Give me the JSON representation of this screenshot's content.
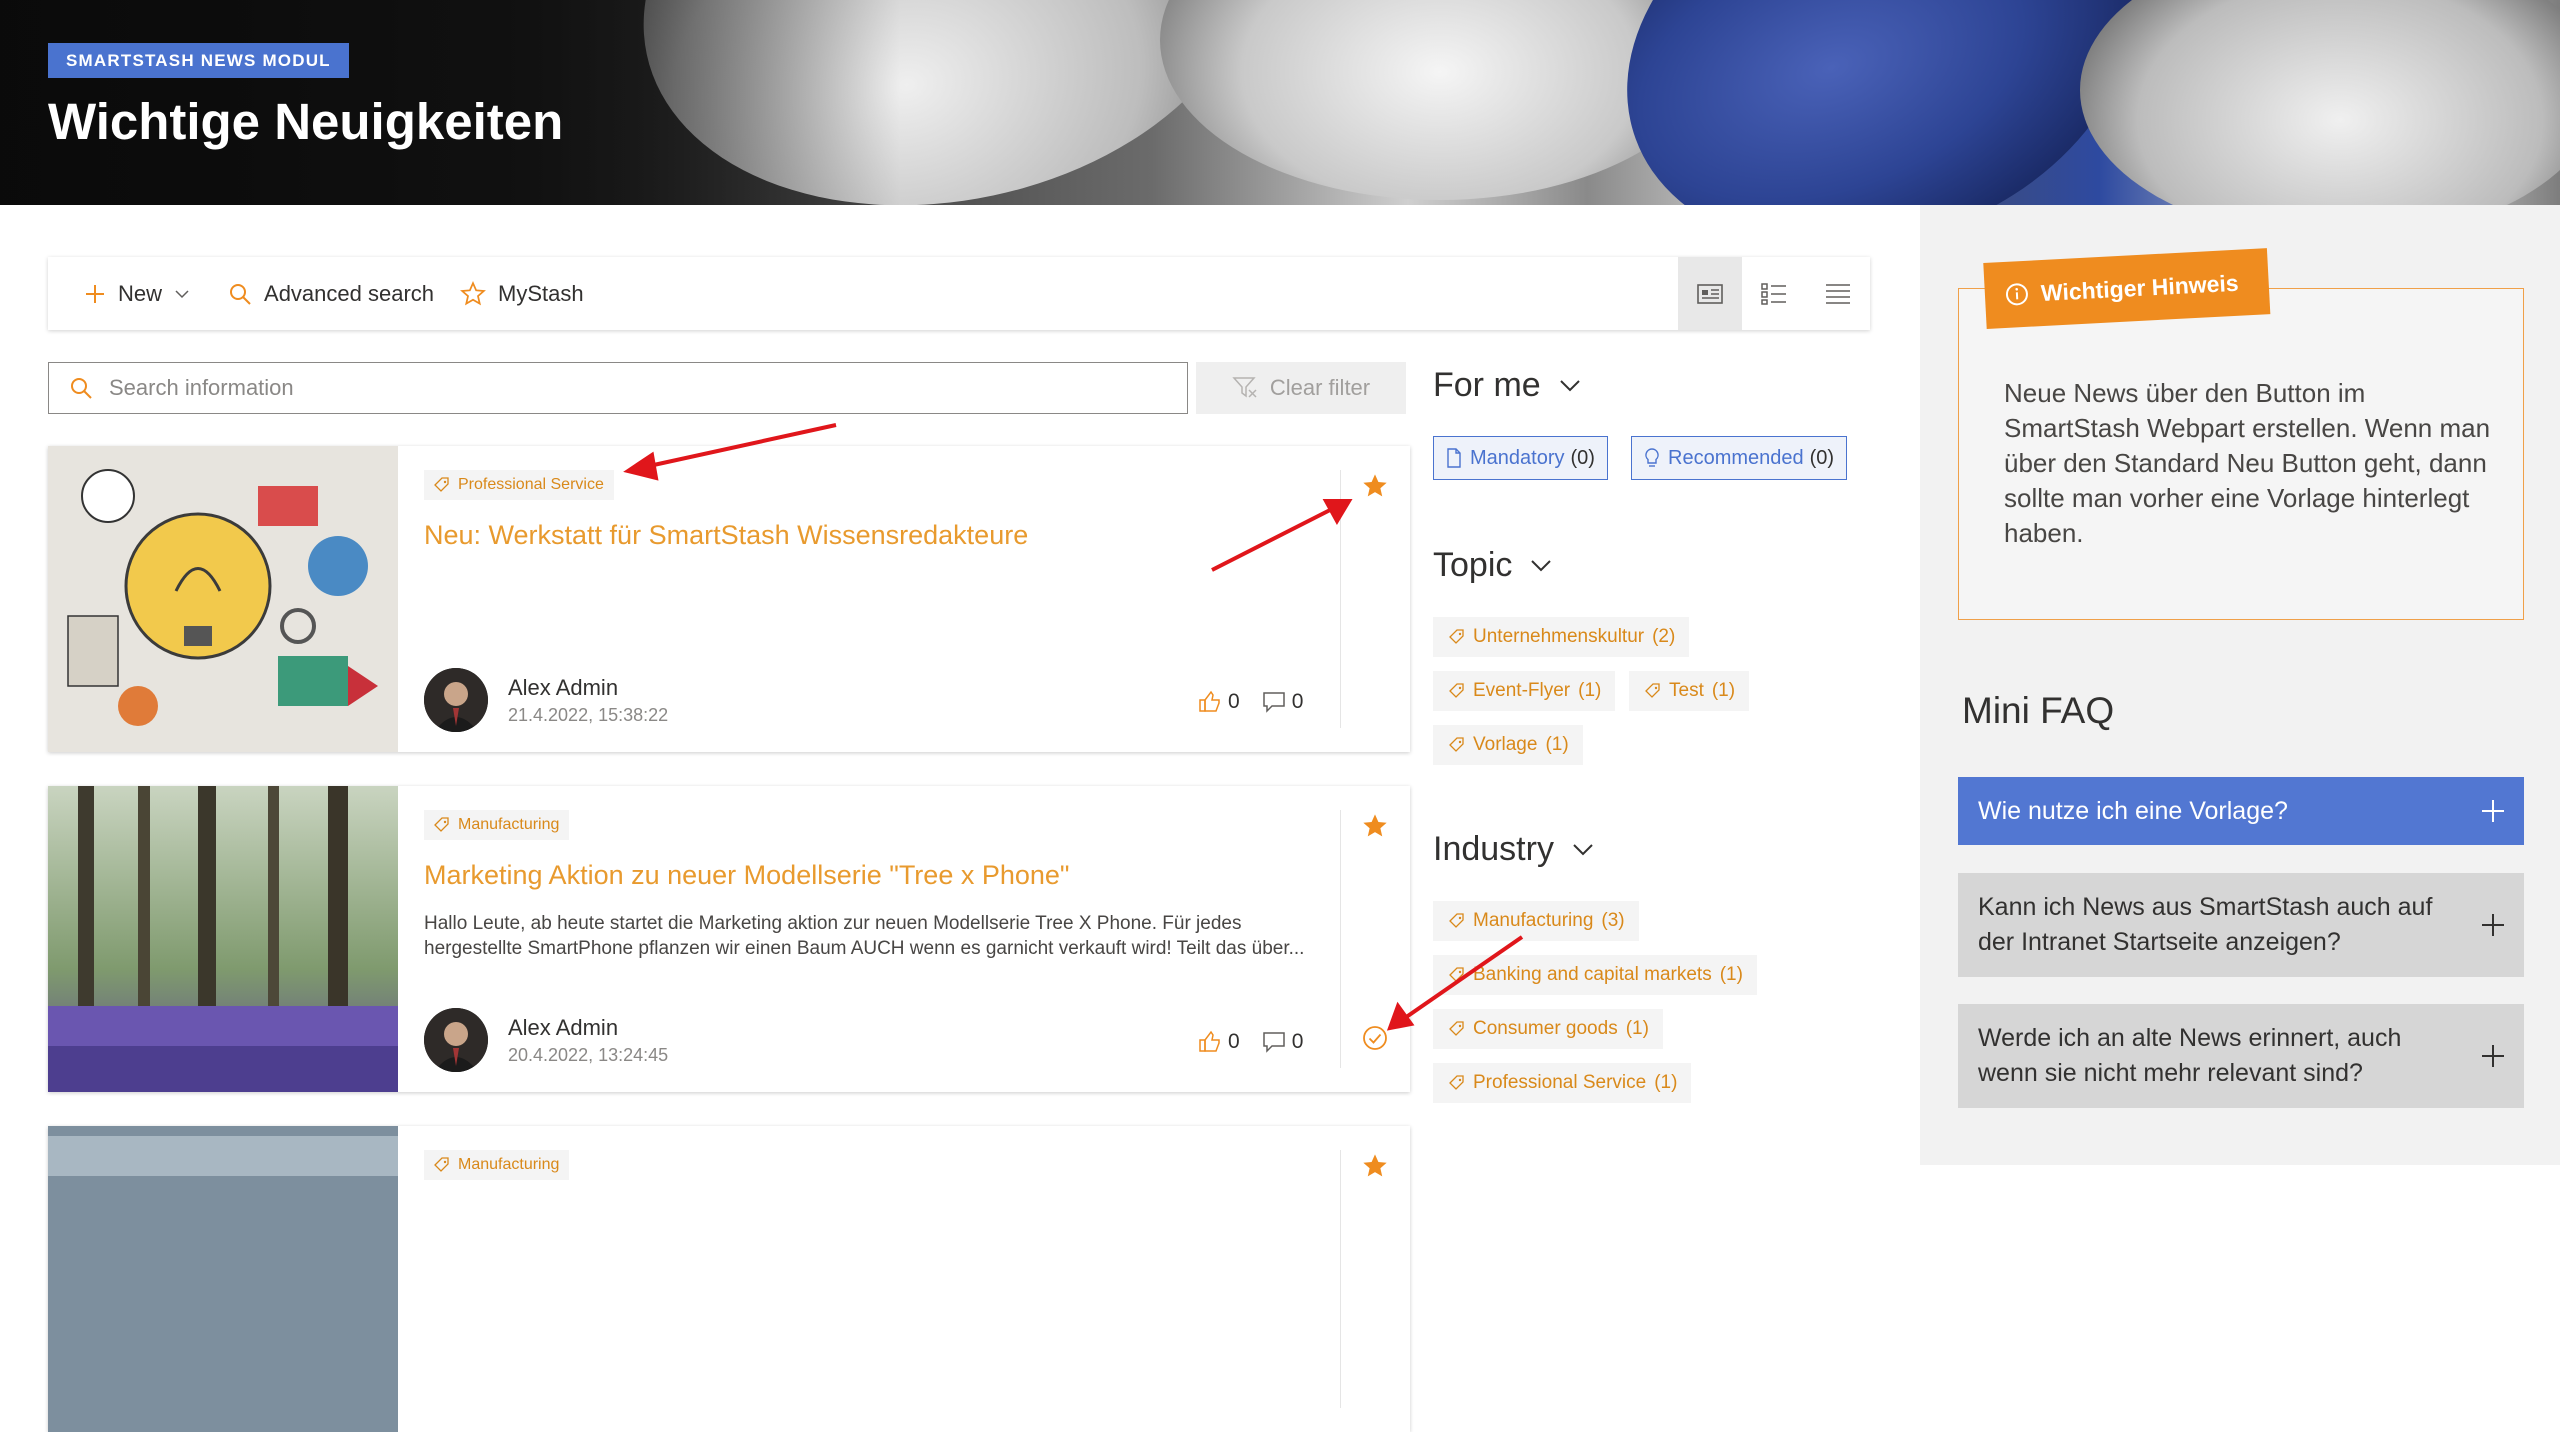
{
  "header": {
    "badge": "SMARTSTASH NEWS MODUL",
    "title": "Wichtige Neuigkeiten"
  },
  "toolbar": {
    "new_label": "New",
    "advanced_search_label": "Advanced search",
    "mystash_label": "MyStash"
  },
  "search": {
    "placeholder": "Search information",
    "clear_filter_label": "Clear filter"
  },
  "news": [
    {
      "tag": "Professional Service",
      "title": "Neu: Werkstatt für SmartStash Wissensredakteure",
      "text": "",
      "author": "Alex Admin",
      "date": "21.4.2022, 15:38:22",
      "likes": "0",
      "comments": "0"
    },
    {
      "tag": "Manufacturing",
      "title": "Marketing Aktion zu neuer Modellserie \"Tree x Phone\"",
      "text": "Hallo Leute, ab heute startet die Marketing aktion zur neuen Modellserie Tree X Phone. Für jedes hergestellte SmartPhone pflanzen wir einen Baum AUCH wenn es garnicht verkauft wird! Teilt das über...",
      "author": "Alex Admin",
      "date": "20.4.2022, 13:24:45",
      "likes": "0",
      "comments": "0"
    },
    {
      "tag": "Manufacturing"
    }
  ],
  "filters": {
    "for_me": {
      "title": "For me",
      "items": [
        {
          "label": "Mandatory",
          "count": "(0)"
        },
        {
          "label": "Recommended",
          "count": "(0)"
        }
      ]
    },
    "topic": {
      "title": "Topic",
      "items": [
        {
          "label": "Unternehmenskultur",
          "count": "(2)"
        },
        {
          "label": "Event-Flyer",
          "count": "(1)"
        },
        {
          "label": "Test",
          "count": "(1)"
        },
        {
          "label": "Vorlage",
          "count": "(1)"
        }
      ]
    },
    "industry": {
      "title": "Industry",
      "items": [
        {
          "label": "Manufacturing",
          "count": "(3)"
        },
        {
          "label": "Banking and capital markets",
          "count": "(1)"
        },
        {
          "label": "Consumer goods",
          "count": "(1)"
        },
        {
          "label": "Professional Service",
          "count": "(1)"
        }
      ]
    }
  },
  "hint": {
    "label": "Wichtiger Hinweis",
    "text": "Neue News über den Button im SmartStash Webpart erstellen. Wenn man über den Standard Neu Button geht, dann sollte man vorher eine Vorlage hinterlegt haben."
  },
  "faq": {
    "title": "Mini FAQ",
    "items": [
      {
        "question": "Wie nutze ich eine Vorlage?"
      },
      {
        "question": "Kann ich News aus SmartStash auch auf der Intranet Startseite anzeigen?"
      },
      {
        "question": "Werde ich an alte News erinnert, auch wenn sie nicht mehr relevant sind?"
      }
    ]
  },
  "colors": {
    "accent_blue": "#4a73cf",
    "accent_orange": "#ef8c1f",
    "tag_orange": "#d9891a",
    "annotation_red": "#e0161b"
  }
}
